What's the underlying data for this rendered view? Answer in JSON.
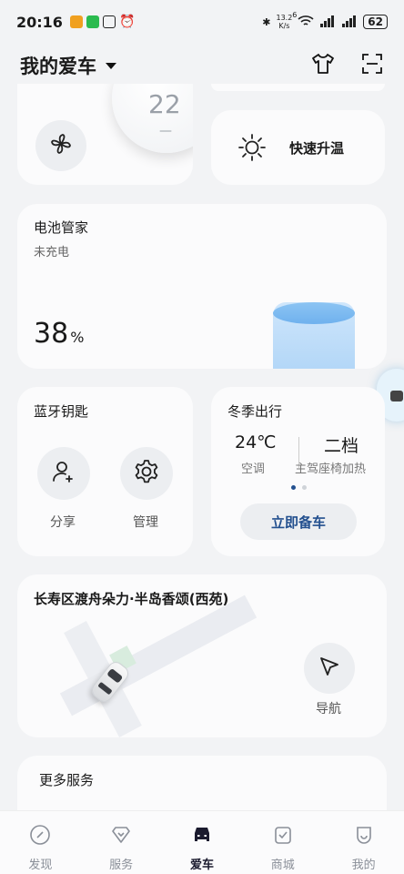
{
  "status_bar": {
    "time": "20:16",
    "net_speed_value": "13.2",
    "net_speed_unit": "K/s",
    "wifi_extra": "6",
    "battery": "62"
  },
  "header": {
    "title": "我的爱车"
  },
  "climate": {
    "temperature": "22",
    "temp_dash": "—",
    "quick_heat_label": "快速升温"
  },
  "battery_card": {
    "title": "电池管家",
    "status": "未充电",
    "percent_value": "38",
    "percent_unit": "%"
  },
  "bluetooth_key": {
    "title": "蓝牙钥匙",
    "share_label": "分享",
    "manage_label": "管理"
  },
  "winter_trip": {
    "title": "冬季出行",
    "ac_value": "24℃",
    "ac_label": "空调",
    "seat_value": "二档",
    "seat_label": "主驾座椅加热",
    "prepare_button": "立即备车"
  },
  "location": {
    "address": "长寿区渡舟朵力·半岛香颂(西苑)",
    "nav_label": "导航"
  },
  "more_services": {
    "title": "更多服务"
  },
  "tabbar": [
    {
      "label": "发现",
      "icon": "compass-icon"
    },
    {
      "label": "服务",
      "icon": "heart-diamond-icon"
    },
    {
      "label": "爱车",
      "icon": "car-icon"
    },
    {
      "label": "商城",
      "icon": "shop-bag-icon"
    },
    {
      "label": "我的",
      "icon": "smile-icon"
    }
  ],
  "colors": {
    "accent": "#1a1a2e",
    "link_blue": "#23508f",
    "battery_blue": "#6fb1ee"
  }
}
